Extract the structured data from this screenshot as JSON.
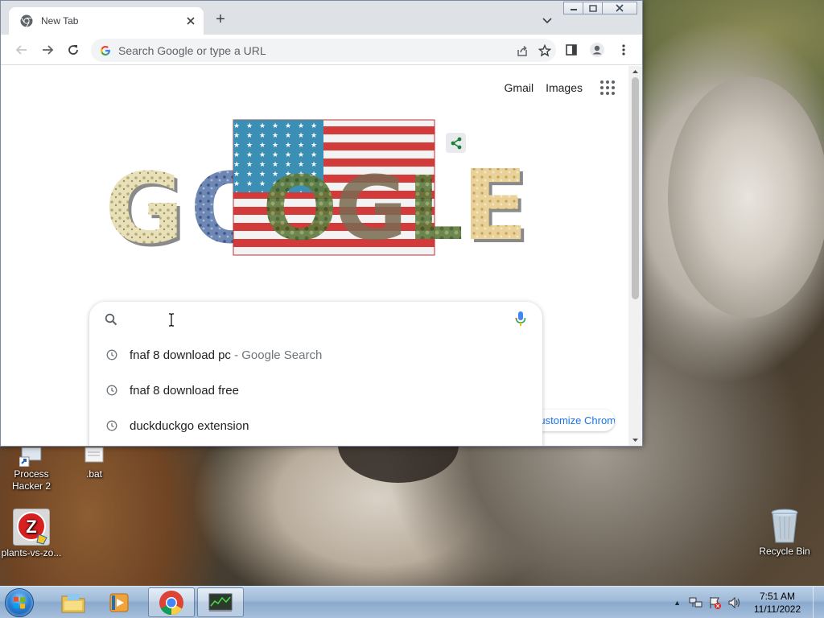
{
  "browser": {
    "tab_title": "New Tab",
    "new_tab_label": "+",
    "omnibox_placeholder": "Search Google or type a URL"
  },
  "ntp": {
    "gmail_link": "Gmail",
    "images_link": "Images",
    "customize_label": "Customize Chrome",
    "search_value": "",
    "suggestions": [
      {
        "text": "fnaf 8 download pc",
        "suffix": " - Google Search"
      },
      {
        "text": "fnaf 8 download free",
        "suffix": ""
      },
      {
        "text": "duckduckgo extension",
        "suffix": ""
      }
    ]
  },
  "desktop": {
    "icons": [
      {
        "label_line1": "Process",
        "label_line2": "Hacker 2"
      },
      {
        "label_line1": ".bat",
        "label_line2": ""
      },
      {
        "label_line1": "plants-vs-zo...",
        "label_line2": ""
      },
      {
        "label_line1": "Recycle Bin",
        "label_line2": ""
      }
    ]
  },
  "taskbar": {
    "clock_time": "7:51 AM",
    "clock_date": "11/11/2022"
  },
  "colors": {
    "accent": "#1a73e8",
    "tab_strip": "#dee1e6",
    "omnibox": "#f1f3f4"
  }
}
